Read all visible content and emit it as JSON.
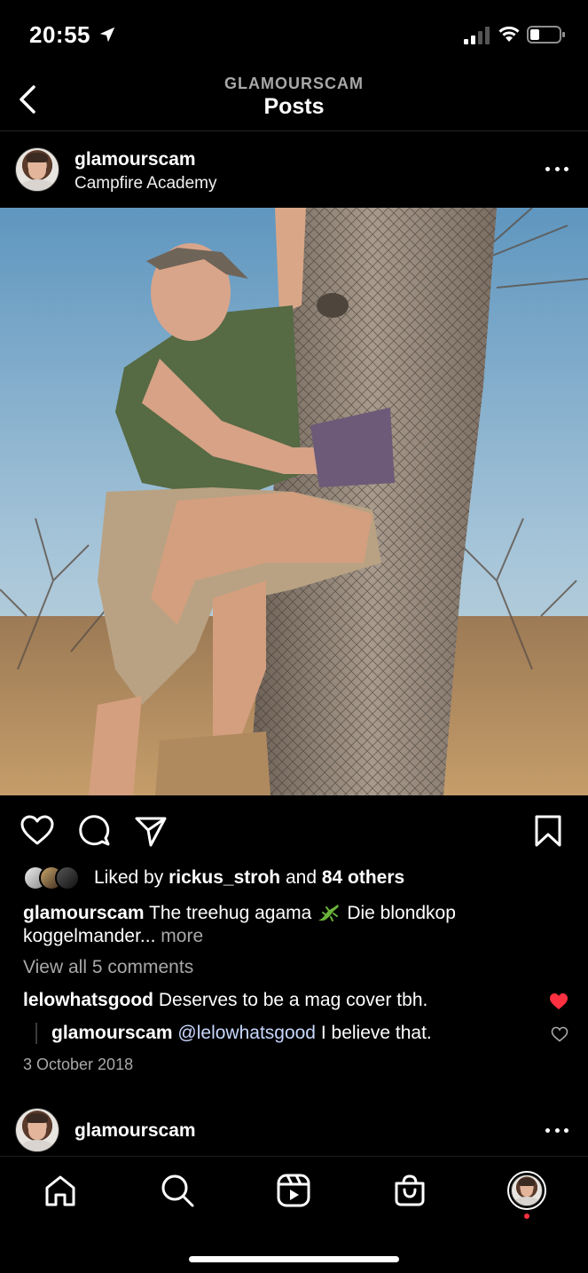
{
  "status_bar": {
    "time": "20:55",
    "icons": [
      "location-arrow-icon",
      "cellular-signal-icon",
      "wifi-icon",
      "battery-icon"
    ]
  },
  "nav": {
    "subtitle": "GLAMOURSCAM",
    "title": "Posts",
    "back_icon": "chevron-left-icon"
  },
  "post": {
    "username": "glamourscam",
    "location": "Campfire Academy",
    "image_description_icon": "photo",
    "likes": {
      "prefix": "Liked by ",
      "liker": "rickus_stroh",
      "middle": " and ",
      "others": "84 others"
    },
    "caption": {
      "username": "glamourscam",
      "text_before_emoji": "The treehug agama",
      "text_after_emoji": "Die blondkop koggelmander...",
      "more": "more"
    },
    "view_comments": "View all 5 comments",
    "comment": {
      "username": "lelowhatsgood",
      "text": "Deserves to be a mag cover tbh.",
      "liked": true
    },
    "reply": {
      "username": "glamourscam",
      "mention": "@lelowhatsgood",
      "text": "I believe that.",
      "liked": false
    },
    "date": "3 October 2018"
  },
  "next_post": {
    "username": "glamourscam"
  },
  "tab_bar": {
    "tabs": [
      "home-icon",
      "search-icon",
      "reels-icon",
      "shop-icon",
      "profile-avatar"
    ]
  },
  "colors": {
    "background": "#000000",
    "secondary_text": "#a8a8a8",
    "like_red": "#ff3040"
  }
}
